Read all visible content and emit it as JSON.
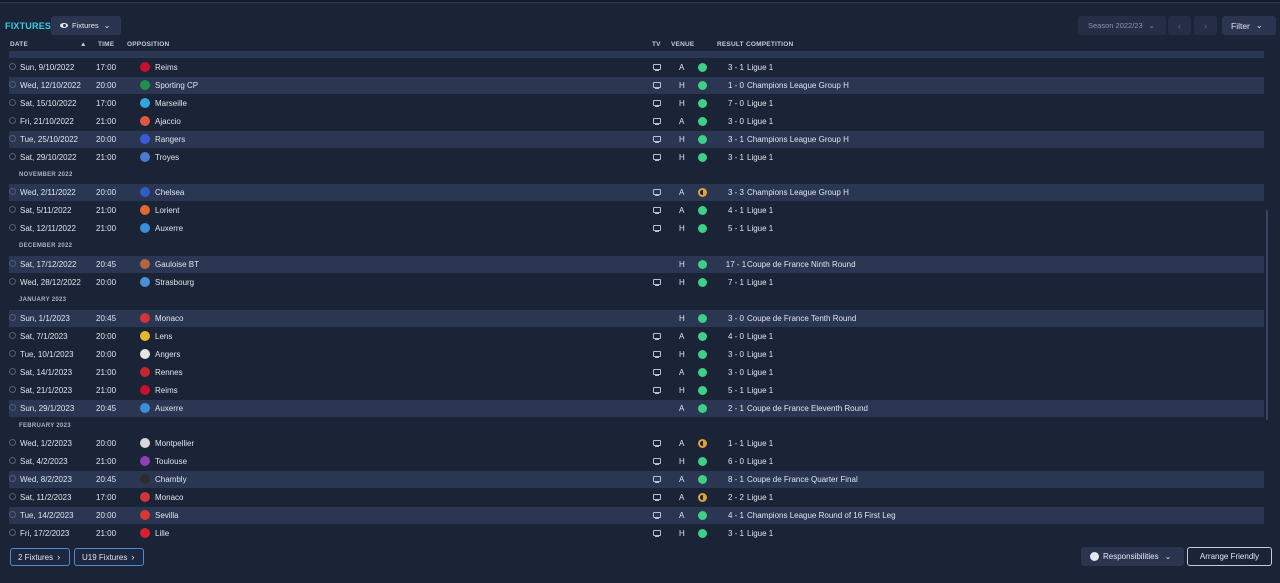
{
  "header": {
    "title": "FIXTURES",
    "view_label": "Fixtures",
    "season_label": "Season 2022/23",
    "filter_label": "Filter"
  },
  "columns": {
    "date": "DATE",
    "time": "TIME",
    "opposition": "OPPOSITION",
    "tv": "TV",
    "venue": "VENUE",
    "result": "RESULT",
    "competition": "COMPETITION"
  },
  "months": [
    "NOVEMBER 2022",
    "DECEMBER 2022",
    "JANUARY 2023",
    "FEBRUARY 2023"
  ],
  "fixtures": [
    {
      "date": "Sun, 9/10/2022",
      "time": "17:00",
      "opp": "Reims",
      "tv": true,
      "venue": "A",
      "outcome": "win",
      "result": "3 - 1",
      "comp": "Ligue 1",
      "badge": "#c8102e"
    },
    {
      "date": "Wed, 12/10/2022",
      "time": "20:00",
      "opp": "Sporting CP",
      "tv": true,
      "venue": "H",
      "outcome": "win",
      "result": "1 - 0",
      "comp": "Champions League Group H",
      "badge": "#1f8f4e"
    },
    {
      "date": "Sat, 15/10/2022",
      "time": "17:00",
      "opp": "Marseille",
      "tv": true,
      "venue": "H",
      "outcome": "win",
      "result": "7 - 0",
      "comp": "Ligue 1",
      "badge": "#2fa6dd"
    },
    {
      "date": "Fri, 21/10/2022",
      "time": "21:00",
      "opp": "Ajaccio",
      "tv": true,
      "venue": "A",
      "outcome": "win",
      "result": "3 - 0",
      "comp": "Ligue 1",
      "badge": "#e2583e"
    },
    {
      "date": "Tue, 25/10/2022",
      "time": "20:00",
      "opp": "Rangers",
      "tv": true,
      "venue": "H",
      "outcome": "win",
      "result": "3 - 1",
      "comp": "Champions League Group H",
      "badge": "#3b5bd6"
    },
    {
      "date": "Sat, 29/10/2022",
      "time": "21:00",
      "opp": "Troyes",
      "tv": true,
      "venue": "H",
      "outcome": "win",
      "result": "3 - 1",
      "comp": "Ligue 1",
      "badge": "#4b7bd1"
    },
    {
      "date": "Wed, 2/11/2022",
      "time": "20:00",
      "opp": "Chelsea",
      "tv": true,
      "venue": "A",
      "outcome": "draw",
      "result": "3 - 3",
      "comp": "Champions League Group H",
      "badge": "#2f5fc4"
    },
    {
      "date": "Sat, 5/11/2022",
      "time": "21:00",
      "opp": "Lorient",
      "tv": true,
      "venue": "A",
      "outcome": "win",
      "result": "4 - 1",
      "comp": "Ligue 1",
      "badge": "#e36a2a"
    },
    {
      "date": "Sat, 12/11/2022",
      "time": "21:00",
      "opp": "Auxerre",
      "tv": true,
      "venue": "H",
      "outcome": "win",
      "result": "5 - 1",
      "comp": "Ligue 1",
      "badge": "#3a8fd8"
    },
    {
      "date": "Sat, 17/12/2022",
      "time": "20:45",
      "opp": "Gauloise BT",
      "tv": false,
      "venue": "H",
      "outcome": "win",
      "result": "17 - 1",
      "comp": "Coupe de France Ninth Round",
      "badge": "#b0683e"
    },
    {
      "date": "Wed, 28/12/2022",
      "time": "20:00",
      "opp": "Strasbourg",
      "tv": true,
      "venue": "H",
      "outcome": "win",
      "result": "7 - 1",
      "comp": "Ligue 1",
      "badge": "#4a8fd6"
    },
    {
      "date": "Sun, 1/1/2023",
      "time": "20:45",
      "opp": "Monaco",
      "tv": false,
      "venue": "H",
      "outcome": "win",
      "result": "3 - 0",
      "comp": "Coupe de France Tenth Round",
      "badge": "#d2343a"
    },
    {
      "date": "Sat, 7/1/2023",
      "time": "20:00",
      "opp": "Lens",
      "tv": true,
      "venue": "A",
      "outcome": "win",
      "result": "4 - 0",
      "comp": "Ligue 1",
      "badge": "#e5b82c"
    },
    {
      "date": "Tue, 10/1/2023",
      "time": "20:00",
      "opp": "Angers",
      "tv": true,
      "venue": "H",
      "outcome": "win",
      "result": "3 - 0",
      "comp": "Ligue 1",
      "badge": "#e4e4e4"
    },
    {
      "date": "Sat, 14/1/2023",
      "time": "21:00",
      "opp": "Rennes",
      "tv": true,
      "venue": "A",
      "outcome": "win",
      "result": "3 - 0",
      "comp": "Ligue 1",
      "badge": "#c8242c"
    },
    {
      "date": "Sat, 21/1/2023",
      "time": "21:00",
      "opp": "Reims",
      "tv": true,
      "venue": "H",
      "outcome": "win",
      "result": "5 - 1",
      "comp": "Ligue 1",
      "badge": "#c8102e"
    },
    {
      "date": "Sun, 29/1/2023",
      "time": "20:45",
      "opp": "Auxerre",
      "tv": false,
      "venue": "A",
      "outcome": "win",
      "result": "2 - 1",
      "comp": "Coupe de France Eleventh Round",
      "badge": "#3a8fd8"
    },
    {
      "date": "Wed, 1/2/2023",
      "time": "20:00",
      "opp": "Montpellier",
      "tv": true,
      "venue": "A",
      "outcome": "draw",
      "result": "1 - 1",
      "comp": "Ligue 1",
      "badge": "#d9d9d9"
    },
    {
      "date": "Sat, 4/2/2023",
      "time": "21:00",
      "opp": "Toulouse",
      "tv": true,
      "venue": "H",
      "outcome": "win",
      "result": "6 - 0",
      "comp": "Ligue 1",
      "badge": "#8f3fb7"
    },
    {
      "date": "Wed, 8/2/2023",
      "time": "20:45",
      "opp": "Chambly",
      "tv": true,
      "venue": "A",
      "outcome": "win",
      "result": "8 - 1",
      "comp": "Coupe de France Quarter Final",
      "badge": "#2d2d2d"
    },
    {
      "date": "Sat, 11/2/2023",
      "time": "17:00",
      "opp": "Monaco",
      "tv": true,
      "venue": "A",
      "outcome": "draw",
      "result": "2 - 2",
      "comp": "Ligue 1",
      "badge": "#d2343a"
    },
    {
      "date": "Tue, 14/2/2023",
      "time": "20:00",
      "opp": "Sevilla",
      "tv": true,
      "venue": "A",
      "outcome": "win",
      "result": "4 - 1",
      "comp": "Champions League Round of 16  First Leg",
      "badge": "#d9382f"
    },
    {
      "date": "Fri, 17/2/2023",
      "time": "21:00",
      "opp": "Lille",
      "tv": true,
      "venue": "H",
      "outcome": "win",
      "result": "3 - 1",
      "comp": "Ligue 1",
      "badge": "#d8202c"
    }
  ],
  "footer": {
    "tab1": "2 Fixtures",
    "tab2": "U19 Fixtures",
    "responsibilities": "Responsibilities",
    "arrange": "Arrange Friendly"
  }
}
